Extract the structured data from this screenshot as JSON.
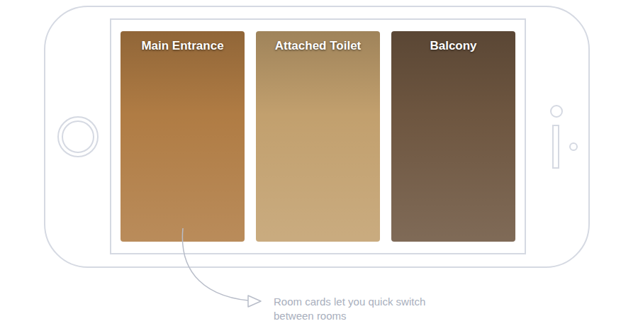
{
  "cards": [
    {
      "title": "Main Entrance",
      "color": "#b07c44"
    },
    {
      "title": "Attached Toilet",
      "color": "#c2a06e"
    },
    {
      "title": "Balcony",
      "color": "#6e5640"
    }
  ],
  "annotation": {
    "lines": [
      "Room cards let you quick switch",
      "between rooms"
    ]
  }
}
